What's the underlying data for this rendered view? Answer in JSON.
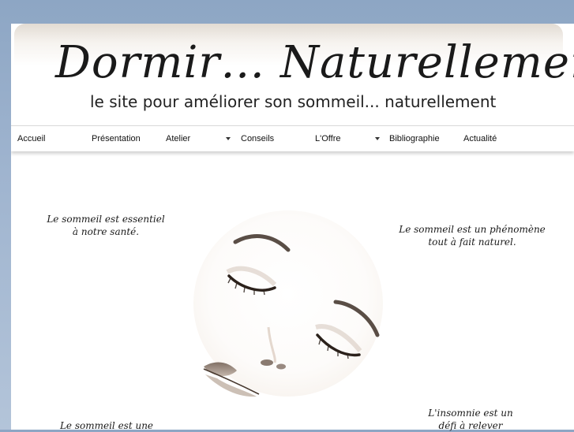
{
  "header": {
    "title": "Dormir… Naturellement",
    "subtitle": "le site pour améliorer son sommeil... naturellement"
  },
  "nav": {
    "items": [
      {
        "label": "Accueil"
      },
      {
        "label": "Présentation"
      },
      {
        "label": "Atelier"
      },
      {
        "label": "Conseils"
      },
      {
        "label": "L'Offre"
      },
      {
        "label": "Bibliographie"
      },
      {
        "label": "Actualité"
      }
    ]
  },
  "content": {
    "quote_top_left": [
      "Le sommeil est essentiel",
      "à notre santé."
    ],
    "quote_top_right": [
      "Le sommeil est un phénomène",
      "tout à fait naturel."
    ],
    "quote_bottom_left": [
      "Le sommeil est une"
    ],
    "quote_bottom_right": [
      "L'insomnie est un",
      "défi à relever"
    ]
  },
  "icons": {
    "dropdown": "caret-down-icon",
    "illustration": "sleeping-face-illustration"
  }
}
